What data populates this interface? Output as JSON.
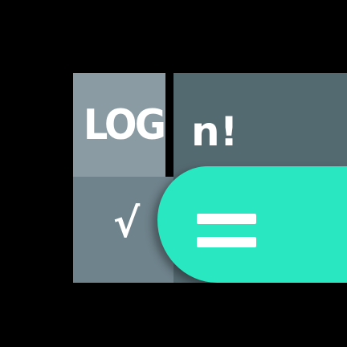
{
  "icon": {
    "name": "calculator-app-icon",
    "keys": {
      "log_label": "LOG",
      "factorial_label": "n!",
      "sqrt_label": "√"
    },
    "equals_label": "=",
    "colors": {
      "background": "#000000",
      "log_key": "#8a9ba4",
      "factorial_key": "#546a71",
      "sqrt_key": "#6f838c",
      "accent": "#29e8c1",
      "text": "#ffffff"
    }
  }
}
